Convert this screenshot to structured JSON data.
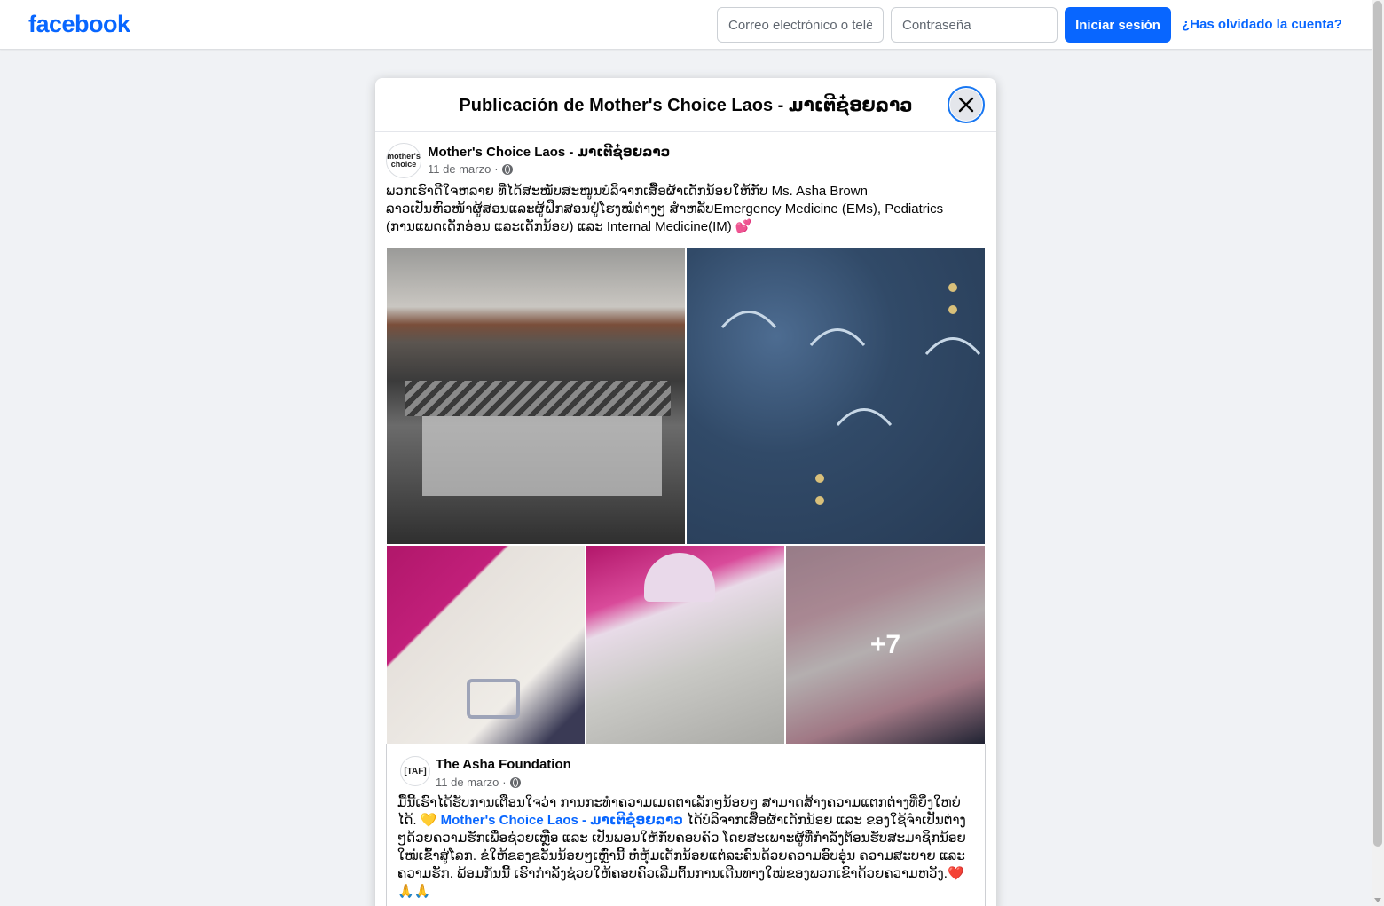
{
  "brand": {
    "logo_text": "facebook",
    "accent_color": "#0866ff"
  },
  "login": {
    "email_placeholder": "Correo electrónico o teléfono",
    "password_placeholder": "Contraseña",
    "login_button": "Iniciar sesión",
    "forgot_link": "¿Has olvidado la cuenta?"
  },
  "modal": {
    "title": "Publicación de Mother's Choice Laos - ມາເຕີຊ໋ອຍລາວ",
    "close_icon": "close-icon"
  },
  "post": {
    "avatar_text": "mother's choice",
    "author": "Mother's Choice Laos - ມາເຕີຊ໋ອຍລາວ",
    "date": "11 de marzo",
    "visibility_icon": "globe-icon",
    "text_lines": [
      "ພວກເຮົາດີໃຈຫລາຍ ທີ່ໄດ້ສະໜັບສະໜູນບໍລິຈາກເສື້ອຜ້າເດັກນ້ອຍໃຫ້ກັບ Ms. Asha Brown",
      "ລາວເປັນຫົວໜ້າຜູ້ສອນແລະຜູ້ຝຶກສອນຢູ່ໂຮງໝໍຕ່າງໆ ສຳຫລັບEmergency Medicine (EMs),  Pediatrics",
      "(ການແພດເດັກອ່ອນ ແລະເດັກນ້ອຍ) ແລະ Internal Medicine(IM) 💕"
    ],
    "more_photos_label": "+7"
  },
  "shared_post": {
    "avatar_text": "[TAF]",
    "author": "The Asha Foundation",
    "date": "11 de marzo",
    "text_before_mention": "ມື້ນີ້ເຮົາໄດ້ຮັບການເຕືອນໃຈວ່າ ການກະທຳຄວາມເມດຕາເລັກໆນ້ອຍໆ ສາມາດສ້າງຄວາມແຕກຕ່າງທີ່ຍິ່ງໃຫຍ່ໄດ້. 💛 ",
    "mention": "Mother's Choice Laos - ມາເຕີຊ໋ອຍລາວ",
    "text_after_mention": "  ໄດ້ບໍລິຈາກເສື້ອຜ້າເດັກນ້ອຍ ແລະ ຂອງໃຊ້ຈຳເປັນຕ່າງໆດ້ວຍຄວາມຮັກເພື່ອຊ່ວຍເຫຼືອ ແລະ ເປັນພອນໃຫ້ກັບຄອບຄົວ ໂດຍສະເພາະຜູ້ທີ່ກຳລັງຕ້ອນຮັບສະມາຊິກນ້ອຍໃໝ່ເຂົ້າສູ່ໂລກ. ຂໍໃຫ້ຂອງຂວັນນ້ອຍໆເຫຼົ່ານີ້ ຫໍ່ຫຸ້ມເດັກນ້ອຍແຕ່ລະຄົນດ້ວຍຄວາມອົບອຸ່ນ ຄວາມສະບາຍ ແລະ ຄວາມຮັກ. ພ້ອມກັນນີ້ ເຮົາກຳລັງຊ່ວຍໃຫ້ຄອບຄົວເລີ່ມຕົ້ນການເດີນທາງໃໝ່ຂອງພວກເຂົາດ້ວຍຄວາມຫວັງ.❤️ 🙏🙏"
  }
}
